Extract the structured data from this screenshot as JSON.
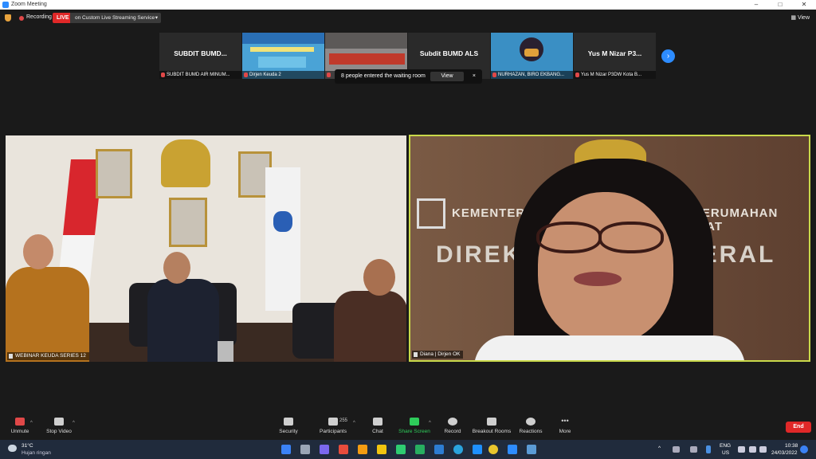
{
  "window": {
    "title": "Zoom Meeting"
  },
  "topbar": {
    "recording_label": "Recording",
    "live_label": "LIVE",
    "live_service": "on Custom Live Streaming Service",
    "view_label": "View"
  },
  "thumbnails": [
    {
      "big_name": "SUBDIT BUMD...",
      "name": "SUBDIT BUMD AIR MINUM..."
    },
    {
      "big_name": "",
      "name": "Dirjen Keuda 2"
    },
    {
      "big_name": "",
      "name": ""
    },
    {
      "big_name": "Subdit BUMD ALS",
      "name": ""
    },
    {
      "big_name": "",
      "name": "NURHAZAN, BIRO EKBANG..."
    },
    {
      "big_name": "Yus M Nizar P3...",
      "name": "Yus M Nizar P3DW Kota B..."
    }
  ],
  "waiting_room": {
    "message": "8 people entered the waiting room",
    "view_button": "View",
    "close": "×"
  },
  "videos": {
    "left_label": "WEBINAR KEUDA SERIES 12",
    "right_label": "Diana | Dirjen OK",
    "right_bg_text_1": "KEMENTERIAN",
    "right_bg_text_2": "AN PERUMAHAN RAKYAT",
    "right_bg_text_3": "DIREK",
    "right_bg_text_4": "DERAL"
  },
  "toolbar": {
    "unmute": "Unmute",
    "stop_video": "Stop Video",
    "security": "Security",
    "participants": "Participants",
    "participants_count": "255",
    "chat": "Chat",
    "share_screen": "Share Screen",
    "record": "Record",
    "breakout_rooms": "Breakout Rooms",
    "reactions": "Reactions",
    "more": "More",
    "end": "End"
  },
  "taskbar": {
    "temperature": "31°C",
    "weather": "Hujan ringan",
    "lang_top": "ENG",
    "lang_bottom": "US",
    "time": "10:38",
    "date": "24/03/2022"
  },
  "colors": {
    "accent_blue": "#2d8cff",
    "live_red": "#e02828",
    "active_speaker_border": "#c9d94a"
  }
}
